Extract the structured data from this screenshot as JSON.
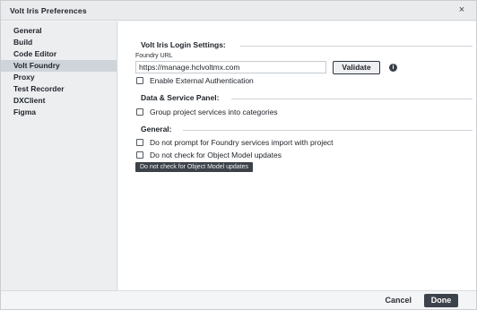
{
  "window": {
    "title": "Volt Iris Preferences",
    "close_glyph": "×"
  },
  "sidebar": {
    "items": [
      {
        "label": "General"
      },
      {
        "label": "Build"
      },
      {
        "label": "Code Editor"
      },
      {
        "label": "Volt Foundry",
        "active": true
      },
      {
        "label": "Proxy"
      },
      {
        "label": "Test Recorder"
      },
      {
        "label": "DXClient"
      },
      {
        "label": "Figma"
      }
    ]
  },
  "login_section": {
    "title": "Volt Iris Login Settings:",
    "url_label": "Foundry URL",
    "url_value": "https://manage.hclvoltmx.com",
    "validate_label": "Validate",
    "info_icon": "info-icon",
    "external_auth_label": "Enable External Authentication",
    "external_auth_checked": false
  },
  "data_section": {
    "title": "Data & Service Panel:",
    "group_label": "Group project services into categories",
    "group_checked": false
  },
  "general_section": {
    "title": "General:",
    "no_import_prompt_label": "Do not prompt for Foundry services import with project",
    "no_import_prompt_checked": false,
    "no_model_check_label": "Do not check for Object Model updates",
    "no_model_check_checked": false,
    "tooltip": "Do not check for Object Model updates"
  },
  "footer": {
    "cancel_label": "Cancel",
    "done_label": "Done"
  },
  "colors": {
    "active_sidebar": "#cfd4da",
    "done_button": "#3d434a",
    "tooltip_bg": "#3c4248"
  }
}
